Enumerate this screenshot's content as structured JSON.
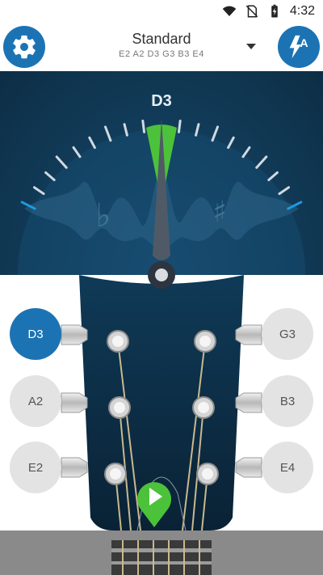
{
  "status_bar": {
    "time": "4:32",
    "icons": [
      "wifi-icon",
      "no-sim-icon",
      "battery-charging-icon"
    ]
  },
  "toolbar": {
    "settings_icon": "gear-icon",
    "tuning_name": "Standard",
    "tuning_notes": "E2 A2 D3 G3 B3 E4",
    "dropdown_icon": "chevron-down-icon",
    "auto_icon": "auto-mode-bolt-icon"
  },
  "meter": {
    "detected_note": "D3",
    "flat_symbol": "♭",
    "sharp_symbol": "♯",
    "in_tune_color": "#4cc23a",
    "accent_color": "#1c73b4"
  },
  "strings": {
    "left": [
      {
        "label": "D3",
        "active": true
      },
      {
        "label": "A2",
        "active": false
      },
      {
        "label": "E2",
        "active": false
      }
    ],
    "right": [
      {
        "label": "G3",
        "active": false
      },
      {
        "label": "B3",
        "active": false
      },
      {
        "label": "E4",
        "active": false
      }
    ]
  },
  "play_button": {
    "icon": "play-icon",
    "color": "#4cc23a"
  }
}
